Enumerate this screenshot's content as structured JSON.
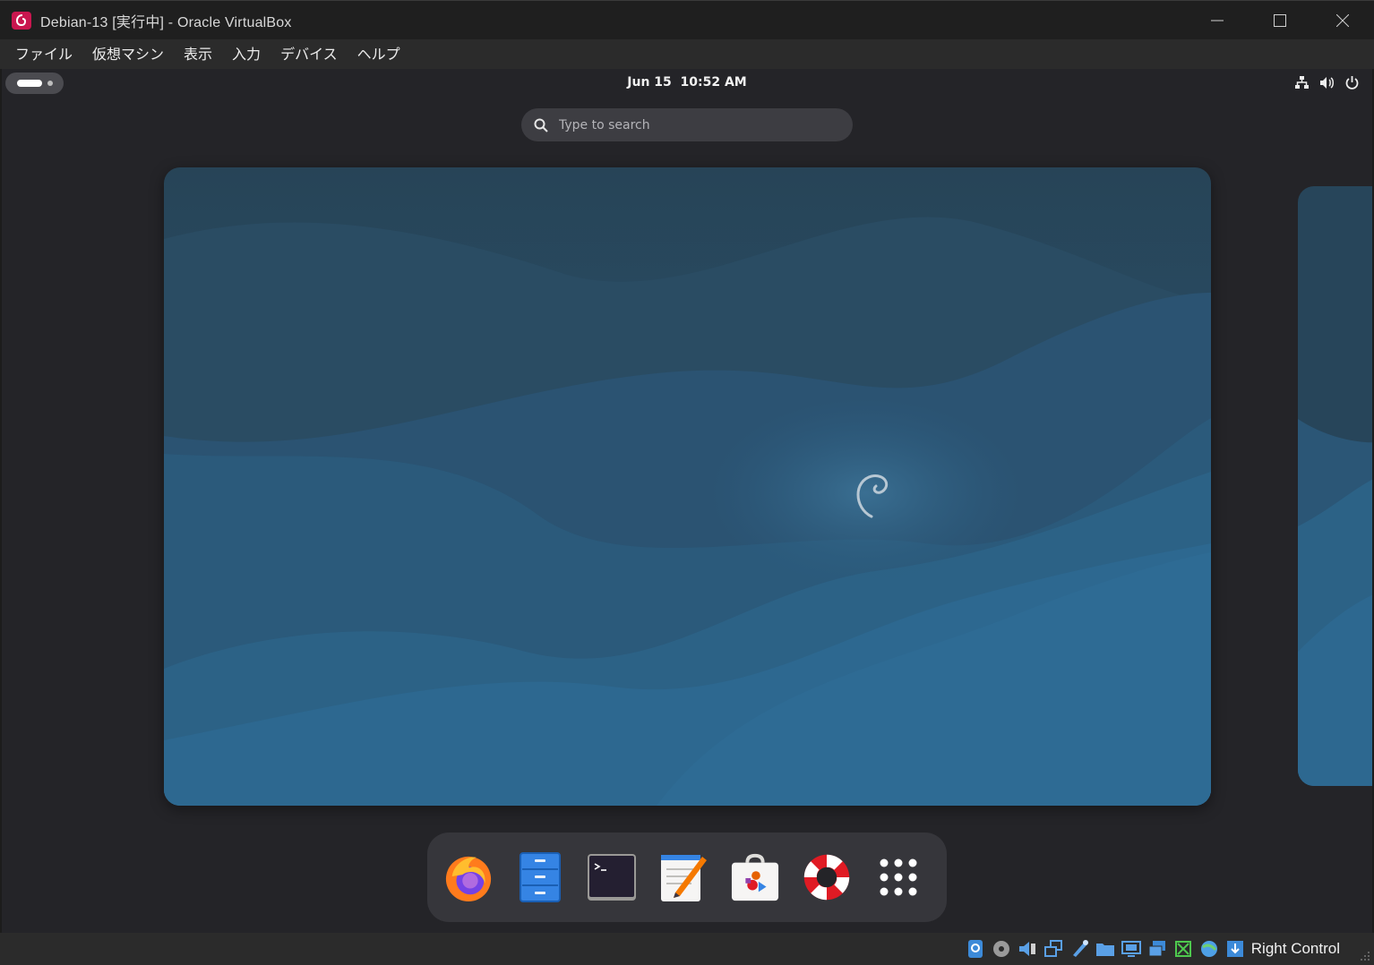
{
  "window": {
    "title": "Debian-13 [実行中] - Oracle VirtualBox",
    "icon": "virtualbox-debian-icon",
    "controls": [
      "minimize-icon",
      "maximize-icon",
      "close-icon"
    ]
  },
  "menubar": {
    "items": [
      "ファイル",
      "仮想マシン",
      "表示",
      "入力",
      "デバイス",
      "ヘルプ"
    ]
  },
  "guest": {
    "clock": "Jun 15  10:52 AM",
    "tray_icons": [
      "network-icon",
      "volume-icon",
      "power-icon"
    ],
    "search": {
      "placeholder": "Type to search"
    },
    "wallpaper_logo": "debian-swirl-icon",
    "dock": [
      {
        "name": "firefox-icon"
      },
      {
        "name": "files-icon"
      },
      {
        "name": "terminal-icon"
      },
      {
        "name": "text-editor-icon"
      },
      {
        "name": "software-icon"
      },
      {
        "name": "help-icon"
      },
      {
        "name": "show-apps-icon"
      }
    ],
    "colors": {
      "background": "#242428",
      "dock": "#36363b",
      "wallpaper_top": "#2a4d63",
      "wallpaper_bottom": "#2b6792"
    }
  },
  "statusbar": {
    "icons": [
      "hard-disk-icon",
      "optical-drive-icon",
      "audio-icon",
      "network-adapter-icon",
      "usb-icon",
      "shared-folders-icon",
      "display-icon",
      "video-capture-icon",
      "guest-additions-icon",
      "cpu-icon",
      "mouse-integration-icon",
      "keyboard-capture-icon"
    ],
    "host_key": "Right Control"
  }
}
